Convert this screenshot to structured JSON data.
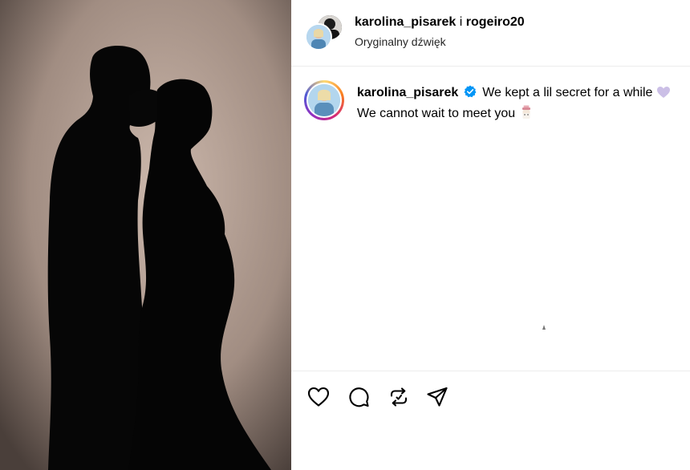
{
  "post": {
    "media_icon": "couple-silhouette-photo",
    "header": {
      "user1": "karolina_pisarek",
      "separator": "i",
      "user2": "rogeiro20",
      "audio": "Oryginalny dźwięk"
    },
    "caption": {
      "username": "karolina_pisarek",
      "verified_icon": "verified-badge-icon",
      "line1": "We kept a lil secret for a while",
      "line1_emoji": "purple-heart-icon",
      "line2": "We cannot wait to meet you",
      "line2_emoji": "baby-bottle-icon"
    },
    "actions": [
      "like-icon",
      "comment-icon",
      "repost-icon",
      "share-icon"
    ]
  },
  "colors": {
    "verified": "#0095f6",
    "text": "#000000",
    "secondary": "#262626",
    "border": "#ececec"
  }
}
